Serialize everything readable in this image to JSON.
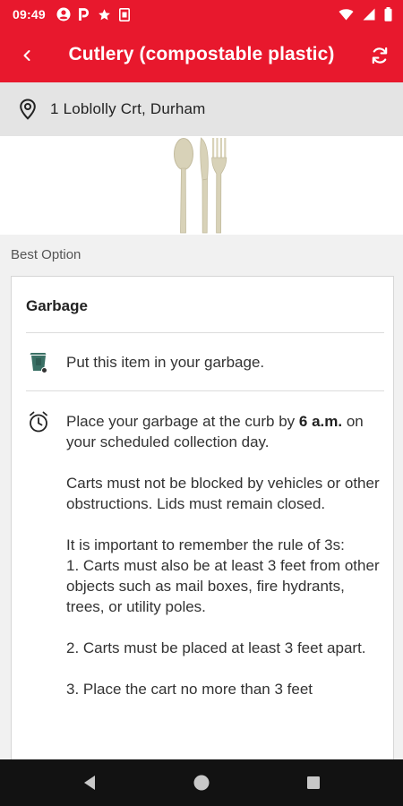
{
  "status_bar": {
    "time": "09:49",
    "icons_left": [
      "account-circle-icon",
      "parking-p-icon",
      "star-icon",
      "sim-card-icon"
    ],
    "icons_right": [
      "wifi-icon",
      "signal-icon",
      "battery-icon"
    ]
  },
  "app_bar": {
    "title": "Cutlery (compostable plastic)",
    "back_icon": "chevron-left-icon",
    "refresh_icon": "refresh-icon",
    "color": "#e8182d"
  },
  "address": {
    "text": "1 Loblolly Crt, Durham",
    "icon": "location-pin-icon"
  },
  "hero": {
    "image": "compostable-cutlery-spoon-knife-fork"
  },
  "best_option": {
    "label": "Best Option",
    "card_title": "Garbage",
    "instruction": "Put this item in your garbage.",
    "instruction_icon": "garbage-cart-icon",
    "schedule_icon": "alarm-clock-icon",
    "paragraphs": [
      {
        "pre": "Place your garbage at the curb by ",
        "bold": "6 a.m.",
        "post": " on your scheduled collection day."
      },
      {
        "text": "Carts must not be blocked by vehicles or other obstructions. Lids must remain closed."
      },
      {
        "text": "It is important to remember the rule of 3s:",
        "line2": "1. Carts must also be at least 3 feet from other objects such as mail boxes, fire hydrants, trees, or utility poles."
      },
      {
        "text": "2. Carts must be placed at least 3 feet apart."
      },
      {
        "text": "3. Place the cart no more than 3 feet"
      }
    ]
  },
  "nav_bar": {
    "buttons": [
      "back-triangle-icon",
      "home-circle-icon",
      "recents-square-icon"
    ]
  }
}
